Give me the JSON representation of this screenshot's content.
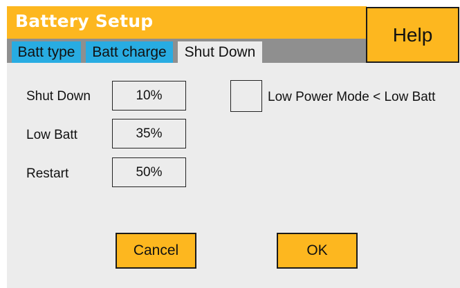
{
  "window": {
    "title": "Battery Setup",
    "help_label": "Help"
  },
  "tabs": [
    {
      "label": "Batt type",
      "active": false
    },
    {
      "label": "Batt charge",
      "active": false
    },
    {
      "label": "Shut Down",
      "active": true
    }
  ],
  "settings": [
    {
      "label": "Shut Down",
      "value": "10%"
    },
    {
      "label": "Low Batt",
      "value": "35%"
    },
    {
      "label": "Restart",
      "value": "50%"
    }
  ],
  "low_power_mode": {
    "label": "Low Power Mode < Low Batt",
    "checked": false
  },
  "buttons": {
    "cancel": "Cancel",
    "ok": "OK"
  },
  "colors": {
    "accent": "#FDB71F",
    "tab_inactive": "#28ACE2",
    "tab_strip": "#8F8F8F",
    "panel": "#ECECEC"
  }
}
